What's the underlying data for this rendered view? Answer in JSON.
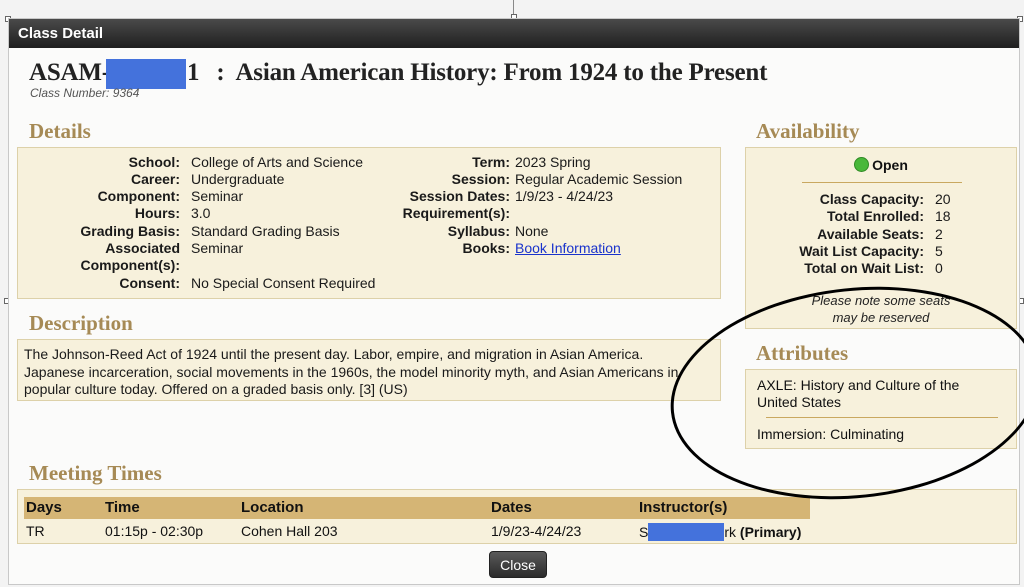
{
  "dialog": {
    "title": "Class Detail",
    "close_label": "Close"
  },
  "course": {
    "subject_prefix": "ASAM-",
    "number_suffix": "1",
    "separator": ":",
    "name": "Asian American History: From 1924 to the Present",
    "class_number_label": "Class Number: 9364"
  },
  "details": {
    "heading": "Details",
    "left": [
      {
        "label": "School:",
        "value": "College of Arts and Science"
      },
      {
        "label": "Career:",
        "value": "Undergraduate"
      },
      {
        "label": "Component:",
        "value": "Seminar"
      },
      {
        "label": "Hours:",
        "value": "3.0"
      },
      {
        "label": "Grading Basis:",
        "value": "Standard Grading Basis"
      },
      {
        "label": "Associated",
        "value": "Seminar"
      },
      {
        "label": "Component(s):",
        "value": ""
      },
      {
        "label": "Consent:",
        "value": "No Special Consent Required"
      }
    ],
    "right": [
      {
        "label": "Term:",
        "value": "2023 Spring"
      },
      {
        "label": "Session:",
        "value": "Regular Academic Session"
      },
      {
        "label": "Session Dates:",
        "value": "1/9/23 - 4/24/23"
      },
      {
        "label": "Requirement(s):",
        "value": ""
      },
      {
        "label": "Syllabus:",
        "value": "None"
      },
      {
        "label": "Books:",
        "value": "Book Information"
      }
    ]
  },
  "availability": {
    "heading": "Availability",
    "status": "Open",
    "status_color": "#49b83a",
    "rows": [
      {
        "label": "Class Capacity:",
        "value": "20"
      },
      {
        "label": "Total Enrolled:",
        "value": "18"
      },
      {
        "label": "Available Seats:",
        "value": "2"
      },
      {
        "label": "Wait List Capacity:",
        "value": "5"
      },
      {
        "label": "Total on Wait List:",
        "value": "0"
      }
    ],
    "note_line1": "Please note some seats",
    "note_line2": "may be reserved"
  },
  "description": {
    "heading": "Description",
    "line1": "The Johnson-Reed Act of 1924 until the present day. Labor, empire, and migration in Asian America.",
    "line2": "Japanese incarceration, social movements in the 1960s, the model minority myth, and Asian Americans in",
    "line3": "popular culture today. Offered on a graded basis only. [3] (US)"
  },
  "attributes": {
    "heading": "Attributes",
    "item1_line1": "AXLE: History and Culture of the",
    "item1_line2": "United States",
    "item2": "Immersion: Culminating"
  },
  "meeting_times": {
    "heading": "Meeting Times",
    "columns": [
      "Days",
      "Time",
      "Location",
      "Dates",
      "Instructor(s)"
    ],
    "rows": [
      {
        "days": "TR",
        "time": "01:15p - 02:30p",
        "location": "Cohen Hall 203",
        "dates": "1/9/23-4/24/23",
        "instructor_start": "S",
        "instructor_end": "rk",
        "role": "(Primary)"
      }
    ]
  },
  "colors": {
    "heading": "#a68a55",
    "panel": "#f7f1dc",
    "table_header": "#d5b575",
    "redaction": "#4472dc"
  }
}
